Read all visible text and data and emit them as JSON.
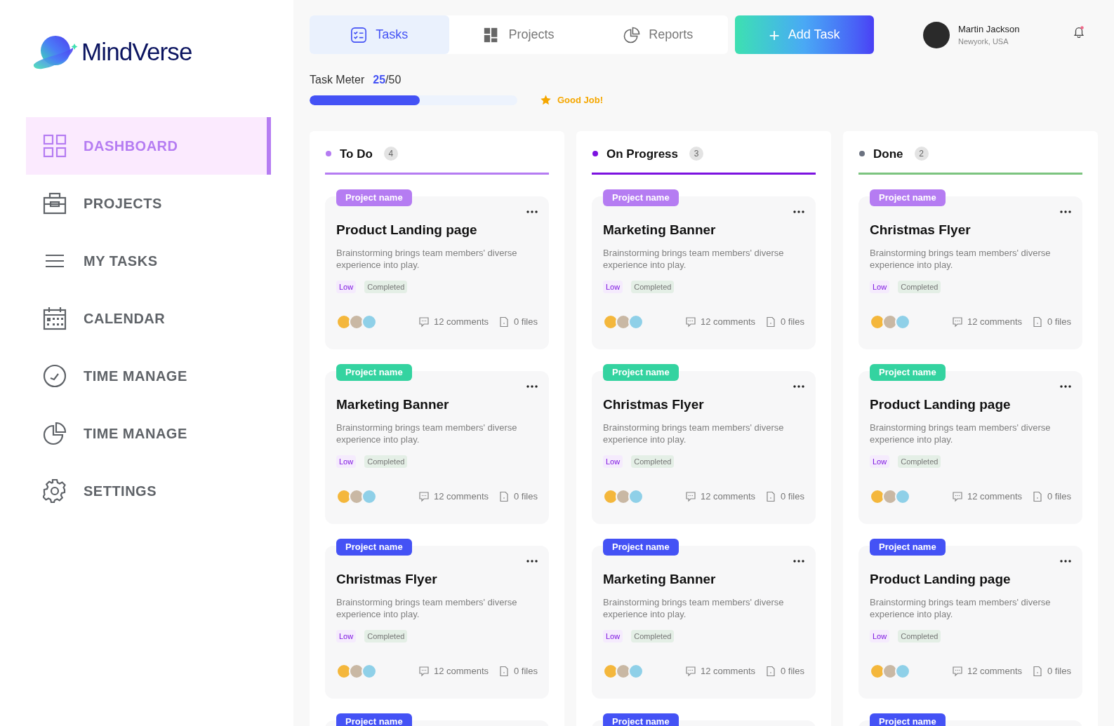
{
  "logo": {
    "text": "MindVerse"
  },
  "sidebar": {
    "items": [
      {
        "label": "DASHBOARD",
        "selected": true
      },
      {
        "label": "PROJECTS",
        "selected": false
      },
      {
        "label": "MY TASKS",
        "selected": false
      },
      {
        "label": "CALENDAR",
        "selected": false
      },
      {
        "label": "TIME MANAGE",
        "selected": false
      },
      {
        "label": "TIME MANAGE",
        "selected": false
      },
      {
        "label": "SETTINGS",
        "selected": false
      }
    ]
  },
  "tabs": [
    {
      "label": "Tasks",
      "selected": true
    },
    {
      "label": "Projects",
      "selected": false
    },
    {
      "label": "Reports",
      "selected": false
    }
  ],
  "add_button": {
    "label": "Add Task",
    "icon": "+"
  },
  "user": {
    "name": "Martin Jackson",
    "location": "Newyork, USA",
    "notification": true
  },
  "task_meter": {
    "label": "Task Meter",
    "done": "25",
    "total": "/50",
    "level": 0.53,
    "message": "Good Job!"
  },
  "columns": [
    {
      "title": "To Do",
      "count": "4",
      "color": "#b57cf2",
      "underline": {
        "color": "#b57cf2"
      },
      "cards": [
        {
          "tag": "Project name",
          "color": "#b57cf2",
          "title": "Product Landing page",
          "description": "Brainstorming brings team members' diverse experience into play.",
          "priority": "Low",
          "status": "Completed",
          "comments": "12 comments",
          "files": "0 files"
        },
        {
          "tag": "Project name",
          "color": "#34d3a0",
          "title": "Marketing Banner",
          "description": "Brainstorming brings team members' diverse experience into play.",
          "priority": "Low",
          "status": "Completed",
          "comments": "12 comments",
          "files": "0 files"
        },
        {
          "tag": "Project name",
          "color": "#4452f5",
          "title": "Christmas Flyer",
          "description": "Brainstorming brings team members' diverse experience into play.",
          "priority": "Low",
          "status": "Completed",
          "comments": "12 comments",
          "files": "0 files"
        },
        {
          "tag": "Project name",
          "color": "#4452f5"
        }
      ]
    },
    {
      "title": "On Progress",
      "count": "3",
      "color": "#7c12e0",
      "underline": {
        "color": "#7c12e0"
      },
      "cards": [
        {
          "tag": "Project name",
          "color": "#b57cf2",
          "title": "Marketing Banner",
          "description": "Brainstorming brings team members' diverse experience into play.",
          "priority": "Low",
          "status": "Completed",
          "comments": "12 comments",
          "files": "0 files"
        },
        {
          "tag": "Project name",
          "color": "#34d3a0",
          "title": "Christmas Flyer",
          "description": "Brainstorming brings team members' diverse experience into play.",
          "priority": "Low",
          "status": "Completed",
          "comments": "12 comments",
          "files": "0 files"
        },
        {
          "tag": "Project name",
          "color": "#4452f5",
          "title": "Marketing Banner",
          "description": "Brainstorming brings team members' diverse experience into play.",
          "priority": "Low",
          "status": "Completed",
          "comments": "12 comments",
          "files": "0 files"
        },
        {
          "tag": "Project name",
          "color": "#4452f5"
        }
      ]
    },
    {
      "title": "Done",
      "count": "2",
      "color": "#6b7280",
      "underline": {
        "color": "#7cc47f"
      },
      "cards": [
        {
          "tag": "Project name",
          "color": "#b57cf2",
          "title": "Christmas Flyer",
          "description": "Brainstorming brings team members' diverse experience into play.",
          "priority": "Low",
          "status": "Completed",
          "comments": "12 comments",
          "files": "0 files"
        },
        {
          "tag": "Project name",
          "color": "#34d3a0",
          "title": "Product Landing page",
          "description": "Brainstorming brings team members' diverse experience into play.",
          "priority": "Low",
          "status": "Completed",
          "comments": "12 comments",
          "files": "0 files"
        },
        {
          "tag": "Project name",
          "color": "#4452f5",
          "title": "Product Landing page",
          "description": "Brainstorming brings team members' diverse experience into play.",
          "priority": "Low",
          "status": "Completed",
          "comments": "12 comments",
          "files": "0 files"
        },
        {
          "tag": "Project name",
          "color": "#4452f5"
        }
      ]
    }
  ]
}
